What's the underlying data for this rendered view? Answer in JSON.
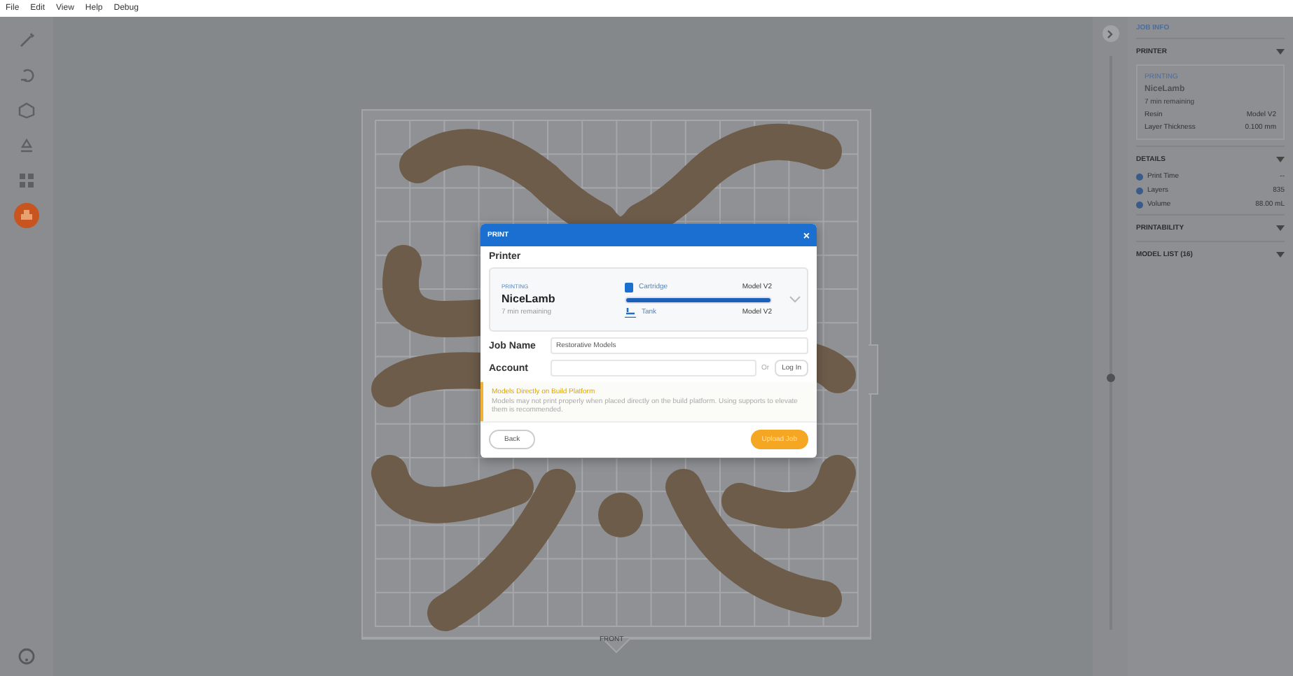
{
  "menu": [
    "File",
    "Edit",
    "View",
    "Help",
    "Debug"
  ],
  "tools": [
    {
      "selected": false
    },
    {
      "selected": false
    },
    {
      "selected": false
    },
    {
      "selected": false
    },
    {
      "selected": false
    },
    {
      "selected": true
    }
  ],
  "canvas": {
    "front_label": "FRONT"
  },
  "layer_slider": {
    "level": 0.44
  },
  "dialog": {
    "title": "PRINT",
    "close": "×",
    "section": "Printer",
    "printer": {
      "status": "PRINTING",
      "name": "NiceLamb",
      "remaining": "7 min remaining",
      "cartridge_label": "Cartridge",
      "cartridge_value": "Model V2",
      "level": 1,
      "tank_label": "Tank",
      "tank_value": "Model V2"
    },
    "job_name_label": "Job Name",
    "job_name": "Restorative Models",
    "account_label": "Account",
    "or": "Or",
    "login": "Log In",
    "warning_title": "Models Directly on Build Platform",
    "warning_text": "Models may not print properly when placed directly on the build platform. Using supports to elevate them is recommended.",
    "back": "Back",
    "upload": "Upload Job"
  },
  "panel": {
    "title": "JOB INFO",
    "printer": {
      "heading": "PRINTER",
      "status": "PRINTING",
      "name": "NiceLamb",
      "remaining": "7 min remaining",
      "rows": [
        {
          "label": "Resin",
          "value": "Model V2"
        },
        {
          "label": "Layer Thickness",
          "value": "0.100 mm"
        }
      ]
    },
    "details": {
      "heading": "DETAILS",
      "rows": [
        {
          "label": "Print Time",
          "value": "--"
        },
        {
          "label": "Layers",
          "value": "835"
        },
        {
          "label": "Volume",
          "value": "88.00 mL"
        }
      ]
    },
    "sections": [
      "PRINTABILITY",
      "MODEL LIST (16)"
    ]
  }
}
